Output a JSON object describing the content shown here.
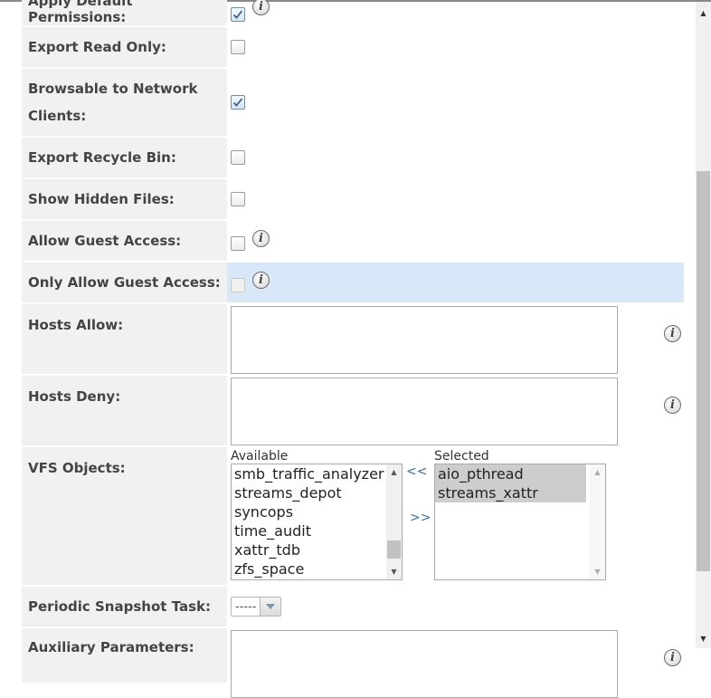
{
  "fields": {
    "apply_default_permissions": {
      "label": "Apply Default Permissions:",
      "checked": true
    },
    "export_read_only": {
      "label": "Export Read Only:",
      "checked": false
    },
    "browsable": {
      "label": "Browsable to Network Clients:",
      "checked": true
    },
    "export_recycle_bin": {
      "label": "Export Recycle Bin:",
      "checked": false
    },
    "show_hidden_files": {
      "label": "Show Hidden Files:",
      "checked": false
    },
    "allow_guest_access": {
      "label": "Allow Guest Access:",
      "checked": false
    },
    "only_allow_guest_access": {
      "label": "Only Allow Guest Access:",
      "checked": false,
      "disabled": true
    },
    "hosts_allow": {
      "label": "Hosts Allow:",
      "value": ""
    },
    "hosts_deny": {
      "label": "Hosts Deny:",
      "value": ""
    },
    "vfs_objects": {
      "label": "VFS Objects:",
      "available_label": "Available",
      "selected_label": "Selected",
      "available": [
        "smb_traffic_analyzer",
        "streams_depot",
        "syncops",
        "time_audit",
        "xattr_tdb",
        "zfs_space"
      ],
      "selected": [
        "aio_pthread",
        "streams_xattr"
      ],
      "move_left": "<<",
      "move_right": ">>"
    },
    "periodic_snapshot_task": {
      "label": "Periodic Snapshot Task:",
      "value": "-----"
    },
    "auxiliary_parameters": {
      "label": "Auxiliary Parameters:",
      "value": ""
    }
  },
  "colors": {
    "label_bg": "#f1f1f1",
    "highlight_row": "#d8e8f8",
    "link_blue": "#3a6fb0"
  }
}
